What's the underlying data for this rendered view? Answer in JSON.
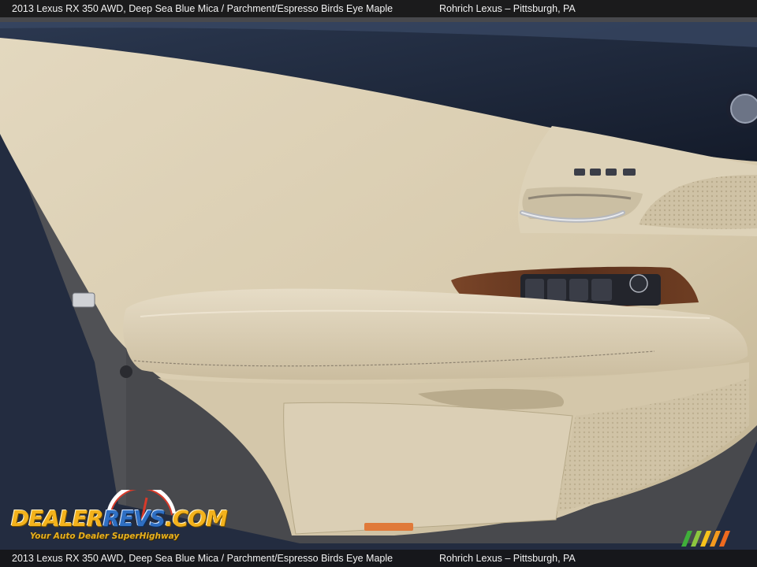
{
  "caption": {
    "vehicle": "2013 Lexus RX 350 AWD,   Deep Sea Blue Mica / Parchment/Espresso Birds Eye Maple",
    "dealer": "Rohrich Lexus – Pittsburgh, PA"
  },
  "watermark": {
    "logo_text": "DealerRevs.com",
    "tagline": "Your Auto Dealer SuperHighway"
  },
  "photo": {
    "subject": "door-panel-interior",
    "colors": {
      "parchment": "#d9cdb2",
      "espresso_wood": "#5e3420",
      "door_frame": "#1f2a3f",
      "pavement": "#4a4b4f"
    }
  }
}
